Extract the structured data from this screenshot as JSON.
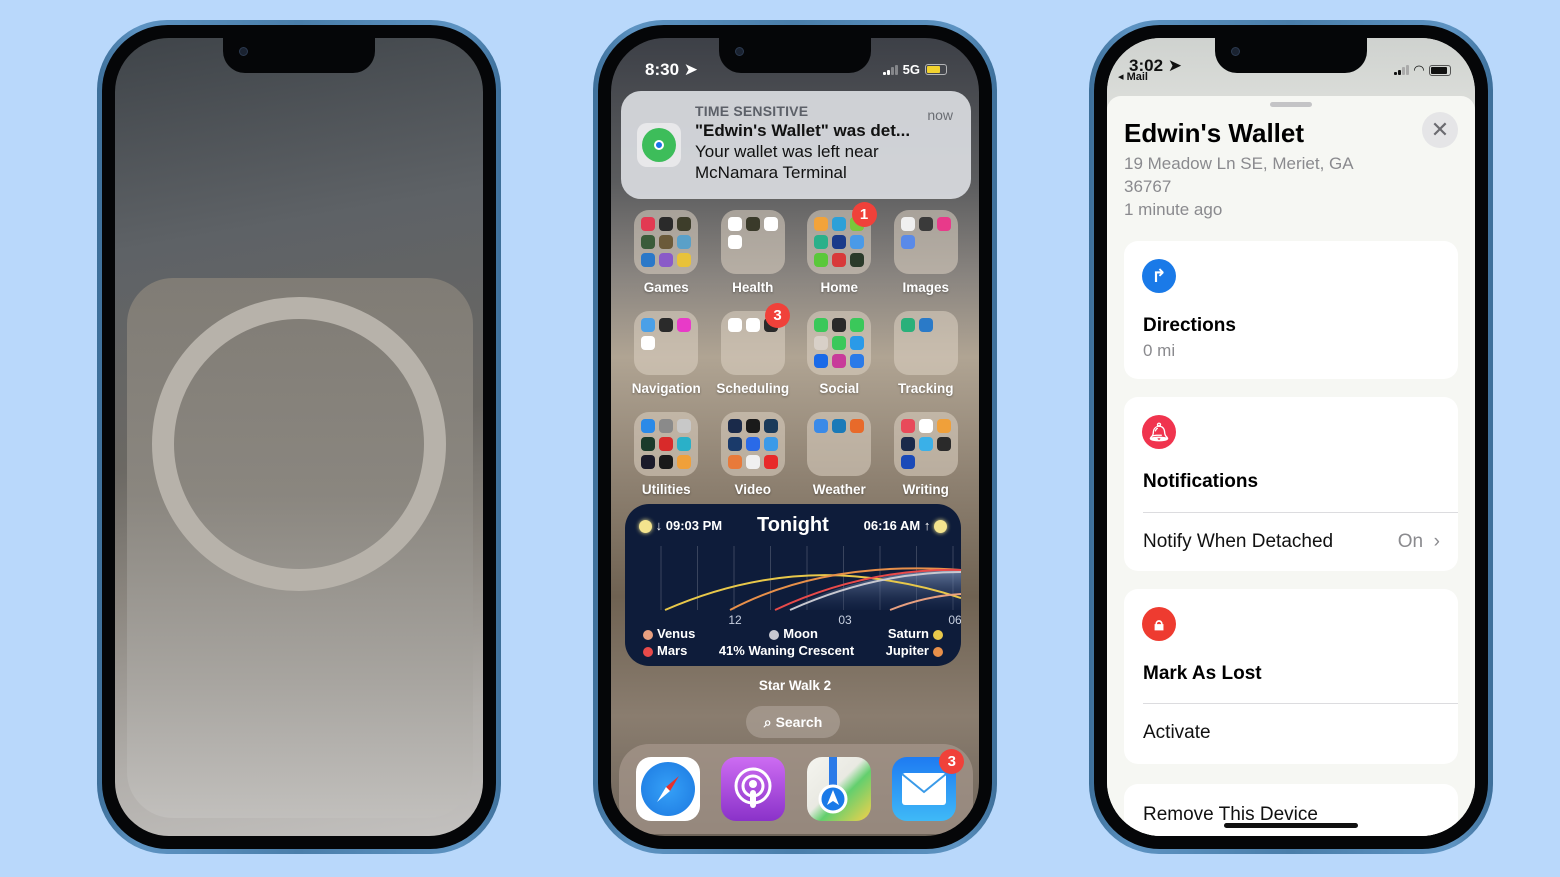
{
  "phone1": {
    "description": "MagSafe charging animation screen",
    "icon": "magsafe-ring"
  },
  "phone2": {
    "status": {
      "time": "8:30",
      "network": "5G",
      "location_icon": "location-arrow-icon",
      "battery": "charging"
    },
    "notification": {
      "category": "TIME SENSITIVE",
      "time": "now",
      "title": "\"Edwin's Wallet\" was det...",
      "body": "Your wallet was left near McNamara Terminal",
      "app_icon": "find-my-icon"
    },
    "folders": [
      {
        "label": "Games",
        "badge": null,
        "colors": [
          "#e23a52",
          "#2a2a2a",
          "#3d3d2a",
          "#3a5c3a",
          "#6b5a3a",
          "#5aa0c8",
          "#2a78c8",
          "#8a5ac8",
          "#e8c23a"
        ]
      },
      {
        "label": "Health",
        "badge": null,
        "colors": [
          "#ffffff",
          "#3a3a2a",
          "#ffffff",
          "#ffffff"
        ]
      },
      {
        "label": "Home",
        "badge": "1",
        "colors": [
          "#f2a33a",
          "#2ca0d8",
          "#7ac83a",
          "#2ab08a",
          "#1a3a8a",
          "#4a9ae8",
          "#5ac83a",
          "#d83a3a",
          "#2a3a2a"
        ]
      },
      {
        "label": "Images",
        "badge": null,
        "colors": [
          "#f0f0f0",
          "#3a3a3a",
          "#e83a8a",
          "#5a8ae8"
        ]
      },
      {
        "label": "Navigation",
        "badge": null,
        "colors": [
          "#4aa0e8",
          "#2a2a2a",
          "#e83ac8",
          "#ffffff"
        ]
      },
      {
        "label": "Scheduling",
        "badge": "3",
        "colors": [
          "#ffffff",
          "#ffffff",
          "#2a2a2a"
        ]
      },
      {
        "label": "Social",
        "badge": null,
        "colors": [
          "#3ac85a",
          "#2a2a2a",
          "#3ac85a",
          "#d8d0c8",
          "#3ac85a",
          "#2a9ae8",
          "#1a6ae8",
          "#c83a9a",
          "#2a7ae8"
        ]
      },
      {
        "label": "Tracking",
        "badge": null,
        "colors": [
          "#2ab07a",
          "#2a7ac8"
        ]
      },
      {
        "label": "Utilities",
        "badge": null,
        "colors": [
          "#2a8ae8",
          "#8a8a8a",
          "#c8c8c8",
          "#1a3a2a",
          "#d82a2a",
          "#2ab0c8",
          "#1a1a2a",
          "#1a1a1a",
          "#f0a03a"
        ]
      },
      {
        "label": "Video",
        "badge": null,
        "colors": [
          "#1a2a4a",
          "#1a1a1a",
          "#1a3a5a",
          "#1a3a6a",
          "#2a6ae8",
          "#3a9ae8",
          "#e87a3a",
          "#f0f0f0",
          "#e82a2a"
        ]
      },
      {
        "label": "Weather",
        "badge": null,
        "colors": [
          "#3a8ae8",
          "#1a7ab8",
          "#e86a2a"
        ]
      },
      {
        "label": "Writing",
        "badge": null,
        "colors": [
          "#e84a5a",
          "#ffffff",
          "#f0a03a",
          "#1a2a4a",
          "#3ab0e8",
          "#2a2a2a",
          "#1a4ab8"
        ]
      }
    ],
    "widget": {
      "title": "Tonight",
      "sunset": "09:03 PM",
      "sunrise": "06:16 AM",
      "x_ticks": [
        "12",
        "03",
        "06"
      ],
      "moon_label": "Moon",
      "moon_phase": "41% Waning Crescent",
      "planets_left": [
        {
          "name": "Venus",
          "color": "#e8a080"
        },
        {
          "name": "Mars",
          "color": "#e84a4a"
        }
      ],
      "planets_right": [
        {
          "name": "Saturn",
          "color": "#e8c84a"
        },
        {
          "name": "Jupiter",
          "color": "#e8904a"
        }
      ],
      "moon_color": "#c8c8d0",
      "caption": "Star Walk 2"
    },
    "search_label": "Search",
    "dock": [
      {
        "name": "safari",
        "badge": null
      },
      {
        "name": "podcasts",
        "badge": null
      },
      {
        "name": "maps",
        "badge": null
      },
      {
        "name": "mail",
        "badge": "3"
      }
    ]
  },
  "phone3": {
    "status": {
      "time": "3:02",
      "back_label": "◂ Mail"
    },
    "item_name": "Edwin's Wallet",
    "address": "19 Meadow Ln SE, Meriet, GA 36767",
    "updated": "1 minute ago",
    "directions": {
      "title": "Directions",
      "distance": "0 mi",
      "color": "#1a7ae8"
    },
    "notifications": {
      "title": "Notifications",
      "row_label": "Notify When Detached",
      "row_value": "On",
      "color": "#f0344e"
    },
    "lost": {
      "title": "Mark As Lost",
      "action": "Activate",
      "color": "#ee3b30"
    },
    "remove_label": "Remove This Device"
  }
}
